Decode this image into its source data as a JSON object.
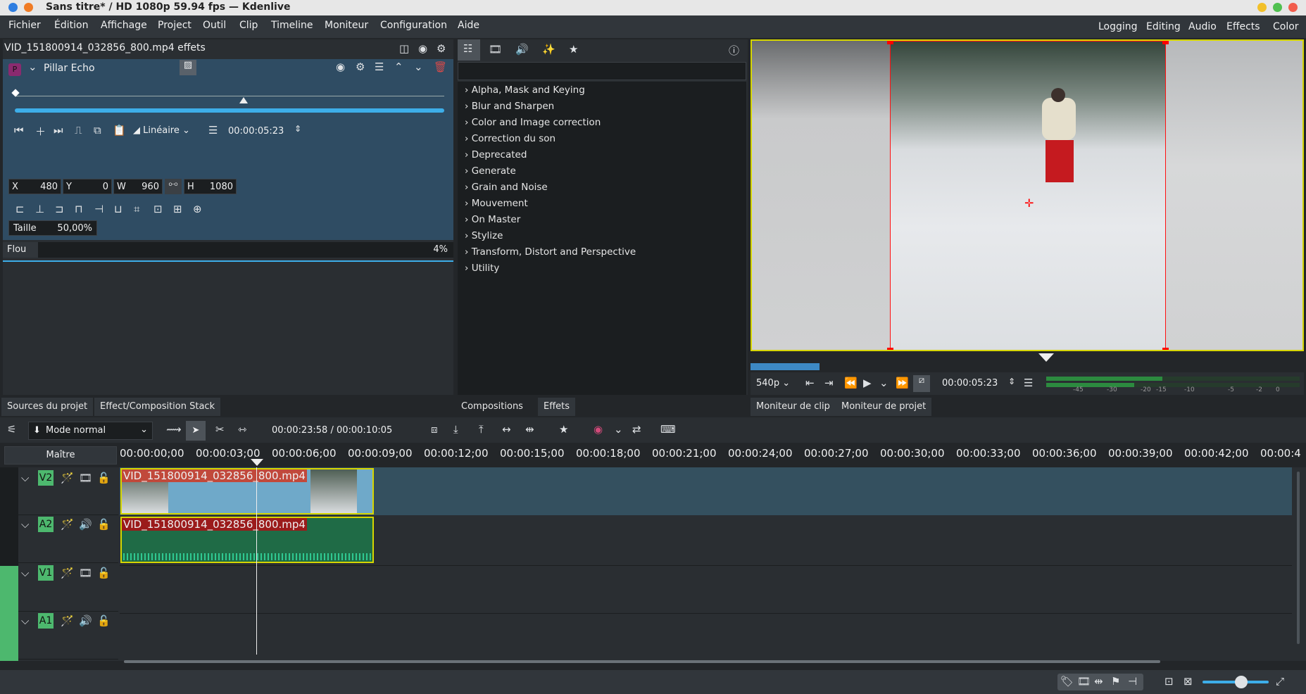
{
  "window": {
    "title": "Sans titre* / HD 1080p 59.94 fps — Kdenlive"
  },
  "menu": [
    "Fichier",
    "Édition",
    "Affichage",
    "Project",
    "Outil",
    "Clip",
    "Timeline",
    "Moniteur",
    "Configuration",
    "Aide"
  ],
  "workspaces": [
    "Logging",
    "Editing",
    "Audio",
    "Effects",
    "Color"
  ],
  "effect_stack": {
    "title": "VID_151800914_032856_800.mp4 effets",
    "effect_name": "Pillar Echo",
    "effect_badge": "P",
    "interp": "Linéaire",
    "timecode": "00:00:05:23",
    "x_label": "X",
    "x": "480",
    "y_label": "Y",
    "y": "0",
    "w_label": "W",
    "w": "960",
    "h_label": "H",
    "h": "1080",
    "size_label": "Taille",
    "size": "50,00%",
    "blur_label": "Flou",
    "blur": "4%"
  },
  "effects_list": {
    "search_placeholder": "",
    "categories": [
      "Alpha, Mask and Keying",
      "Blur and Sharpen",
      "Color and Image correction",
      "Correction du son",
      "Deprecated",
      "Generate",
      "Grain and Noise",
      "Mouvement",
      "On Master",
      "Stylize",
      "Transform, Distort and Perspective",
      "Utility"
    ]
  },
  "monitor": {
    "resolution": "540p",
    "timecode": "00:00:05:23",
    "meter_ticks": [
      "-45",
      "-30",
      "-20",
      "-15",
      "-10",
      "-5",
      "-2",
      "0"
    ]
  },
  "tabs_left": [
    "Sources du projet",
    "Effect/Composition Stack"
  ],
  "tabs_mid": [
    "Compositions",
    "Effets"
  ],
  "tabs_right": [
    "Moniteur de clip",
    "Moniteur de projet"
  ],
  "timeline": {
    "mode": "Mode normal",
    "timecode": "00:00:23:58 / 00:00:10:05",
    "master": "Maître",
    "ruler": [
      "00:00:00;00",
      "00:00:03;00",
      "00:00:06;00",
      "00:00:09;00",
      "00:00:12;00",
      "00:00:15;00",
      "00:00:18;00",
      "00:00:21;00",
      "00:00:24;00",
      "00:00:27;00",
      "00:00:30;00",
      "00:00:33;00",
      "00:00:36;00",
      "00:00:39;00",
      "00:00:42;00",
      "00:00:4"
    ],
    "tracks": [
      "V2",
      "A2",
      "V1",
      "A1"
    ],
    "clip_v2": "VID_151800914_032856_800.mp4",
    "clip_a2": "VID_151800914_032856_800.mp4"
  },
  "colors": {
    "accent": "#3daee9",
    "track_label": "#4db86e",
    "clip_video": "#6fa9c9",
    "clip_audio": "#1f6b46",
    "selection": "#d6d600"
  }
}
